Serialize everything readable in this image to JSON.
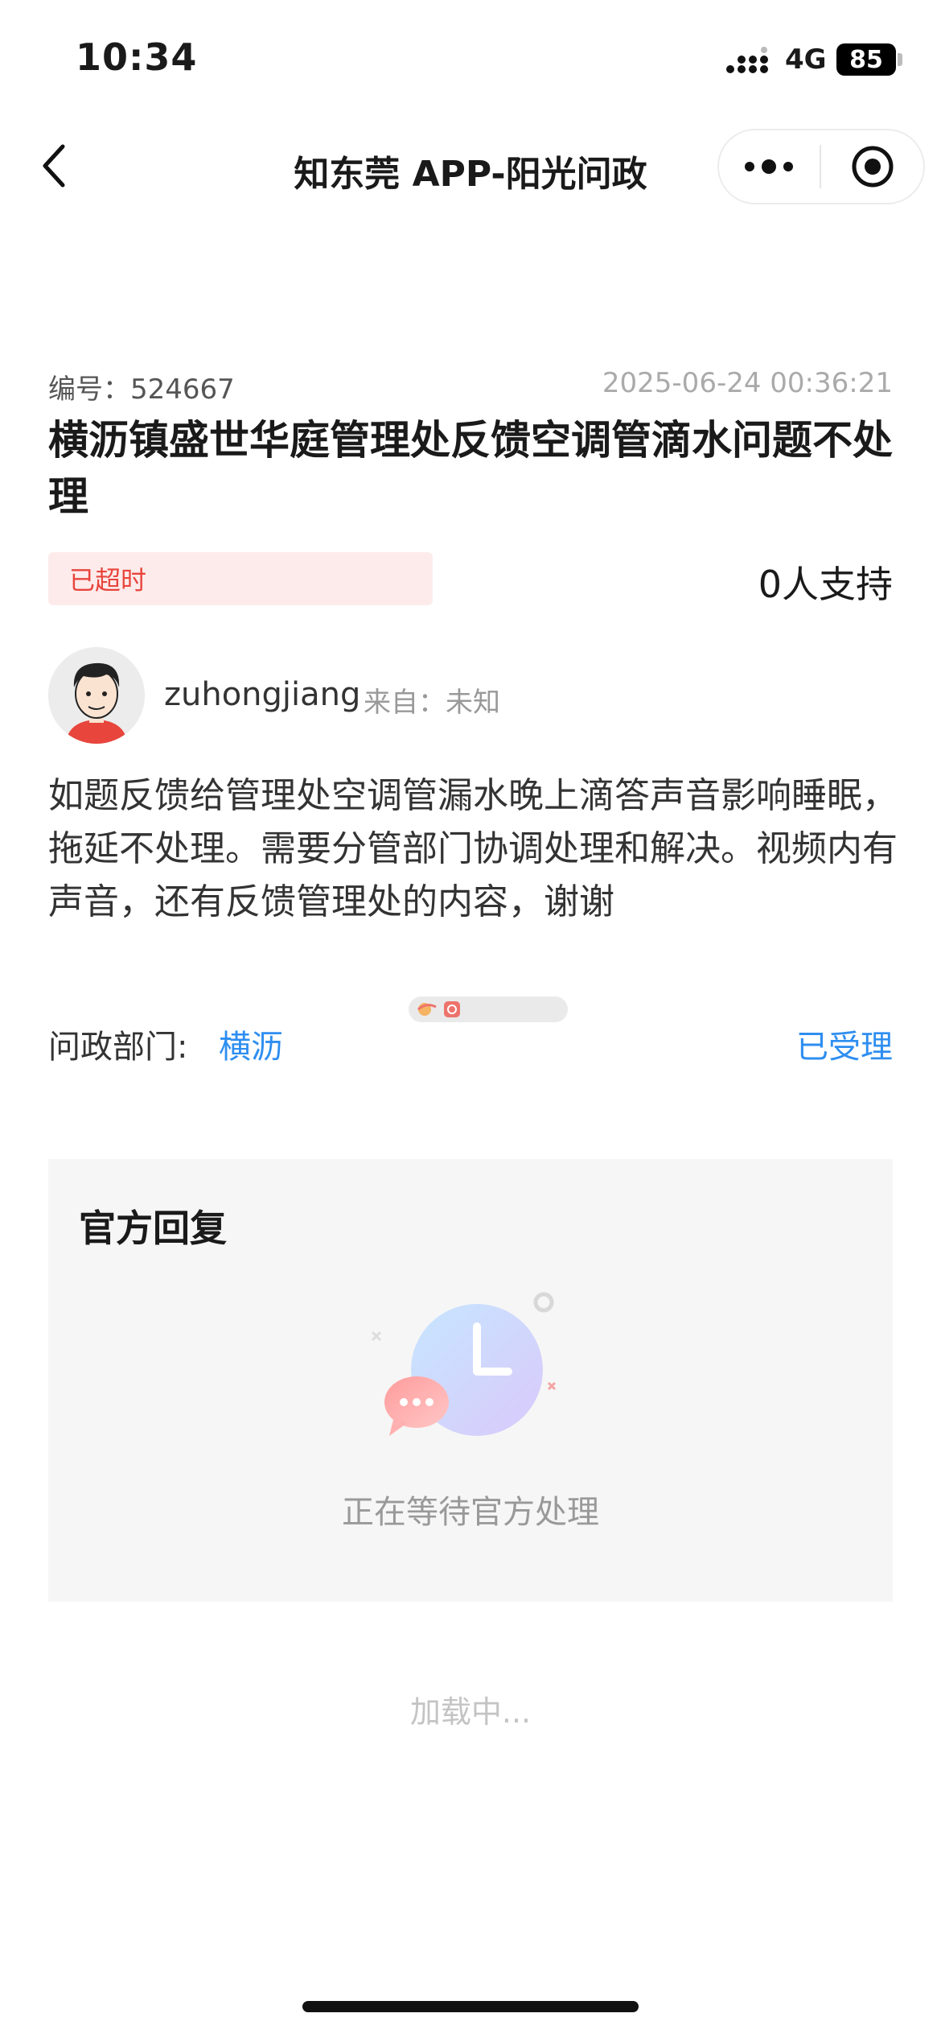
{
  "status_bar": {
    "time": "10:34",
    "network": "4G",
    "battery": "85"
  },
  "nav": {
    "title": "知东莞 APP-阳光问政"
  },
  "post": {
    "number_label": "编号：524667",
    "timestamp": "2025-06-24 00:36:21",
    "title": "横沥镇盛世华庭管理处反馈空调管滴水问题不处理",
    "overdue_badge": "已超时",
    "support_count": "0人支持",
    "username": "zuhongjiang",
    "source": "来自：未知",
    "content": "如题反馈给管理处空调管漏水晚上滴答声音影响睡眠，拖延不处理。需要分管部门协调处理和解决。视频内有声音，还有反馈管理处的内容，谢谢",
    "dept_label": "问政部门:",
    "dept_value": "横沥",
    "status": "已受理"
  },
  "reply": {
    "title": "官方回复",
    "waiting_text": "正在等待官方处理"
  },
  "loading_text": "加载中...",
  "colors": {
    "accent_blue": "#2e8ef0",
    "overdue_red": "#e8453c",
    "badge_bg": "#fdebeb"
  },
  "icons": [
    "back-chevron-icon",
    "more-dots-icon",
    "close-target-icon",
    "clock-icon",
    "chat-bubble-icon"
  ]
}
